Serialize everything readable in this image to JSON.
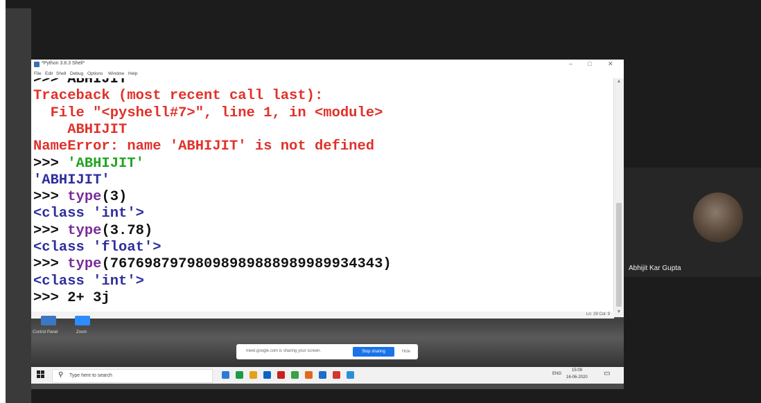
{
  "idle": {
    "title": "*Python 3.8.3 Shell*",
    "window_controls": [
      "–",
      "□",
      "✕"
    ],
    "menu": [
      "File",
      "Edit",
      "Shell",
      "Debug",
      "Options",
      "Window",
      "Help"
    ],
    "status": "Ln: 29  Col: 9"
  },
  "shell_lines": [
    {
      "segments": [
        {
          "text": ">>> ABHIJIT",
          "color": "blk"
        }
      ]
    },
    {
      "segments": [
        {
          "text": "Traceback (most recent call last):",
          "color": "red"
        }
      ]
    },
    {
      "segments": [
        {
          "text": "  File \"<pyshell#7>\", line 1, in <module>",
          "color": "red"
        }
      ]
    },
    {
      "segments": [
        {
          "text": "    ABHIJIT",
          "color": "red"
        }
      ]
    },
    {
      "segments": [
        {
          "text": "NameError: name 'ABHIJIT' is not defined",
          "color": "red"
        }
      ]
    },
    {
      "segments": [
        {
          "text": ">>> ",
          "color": "blk"
        },
        {
          "text": "'ABHIJIT'",
          "color": "grn"
        }
      ]
    },
    {
      "segments": [
        {
          "text": "'ABHIJIT'",
          "color": "blu"
        }
      ]
    },
    {
      "segments": [
        {
          "text": ">>> ",
          "color": "blk"
        },
        {
          "text": "type",
          "color": "pur"
        },
        {
          "text": "(3)",
          "color": "blk"
        }
      ]
    },
    {
      "segments": [
        {
          "text": "<class 'int'>",
          "color": "blu"
        }
      ]
    },
    {
      "segments": [
        {
          "text": ">>> ",
          "color": "blk"
        },
        {
          "text": "type",
          "color": "pur"
        },
        {
          "text": "(3.78)",
          "color": "blk"
        }
      ]
    },
    {
      "segments": [
        {
          "text": "<class 'float'>",
          "color": "blu"
        }
      ]
    },
    {
      "segments": [
        {
          "text": ">>> ",
          "color": "blk"
        },
        {
          "text": "type",
          "color": "pur"
        },
        {
          "text": "(76769879798098989888989989934343)",
          "color": "blk"
        }
      ]
    },
    {
      "segments": [
        {
          "text": "<class 'int'>",
          "color": "blu"
        }
      ]
    },
    {
      "segments": [
        {
          "text": ">>> 2+ 3j",
          "color": "blk"
        }
      ]
    }
  ],
  "desktop": {
    "icons": [
      "Control Panel",
      "Zoom"
    ]
  },
  "sharing": {
    "message": "meet.google.com is sharing your screen.",
    "stop_label": "Stop sharing",
    "hide_label": "Hide"
  },
  "taskbar": {
    "search_placeholder": "Type here to search",
    "lang": "ENG",
    "time": "15:09",
    "date": "16-06-2020",
    "app_colors": [
      "#2d7bd6",
      "#1b9b4a",
      "#e0a21b",
      "#0a64c4",
      "#c8201c",
      "#37a24a",
      "#e0681b",
      "#1f6bc7",
      "#d1372d",
      "#2b8fd8"
    ]
  },
  "participant": {
    "name": "Abhijit Kar Gupta"
  }
}
